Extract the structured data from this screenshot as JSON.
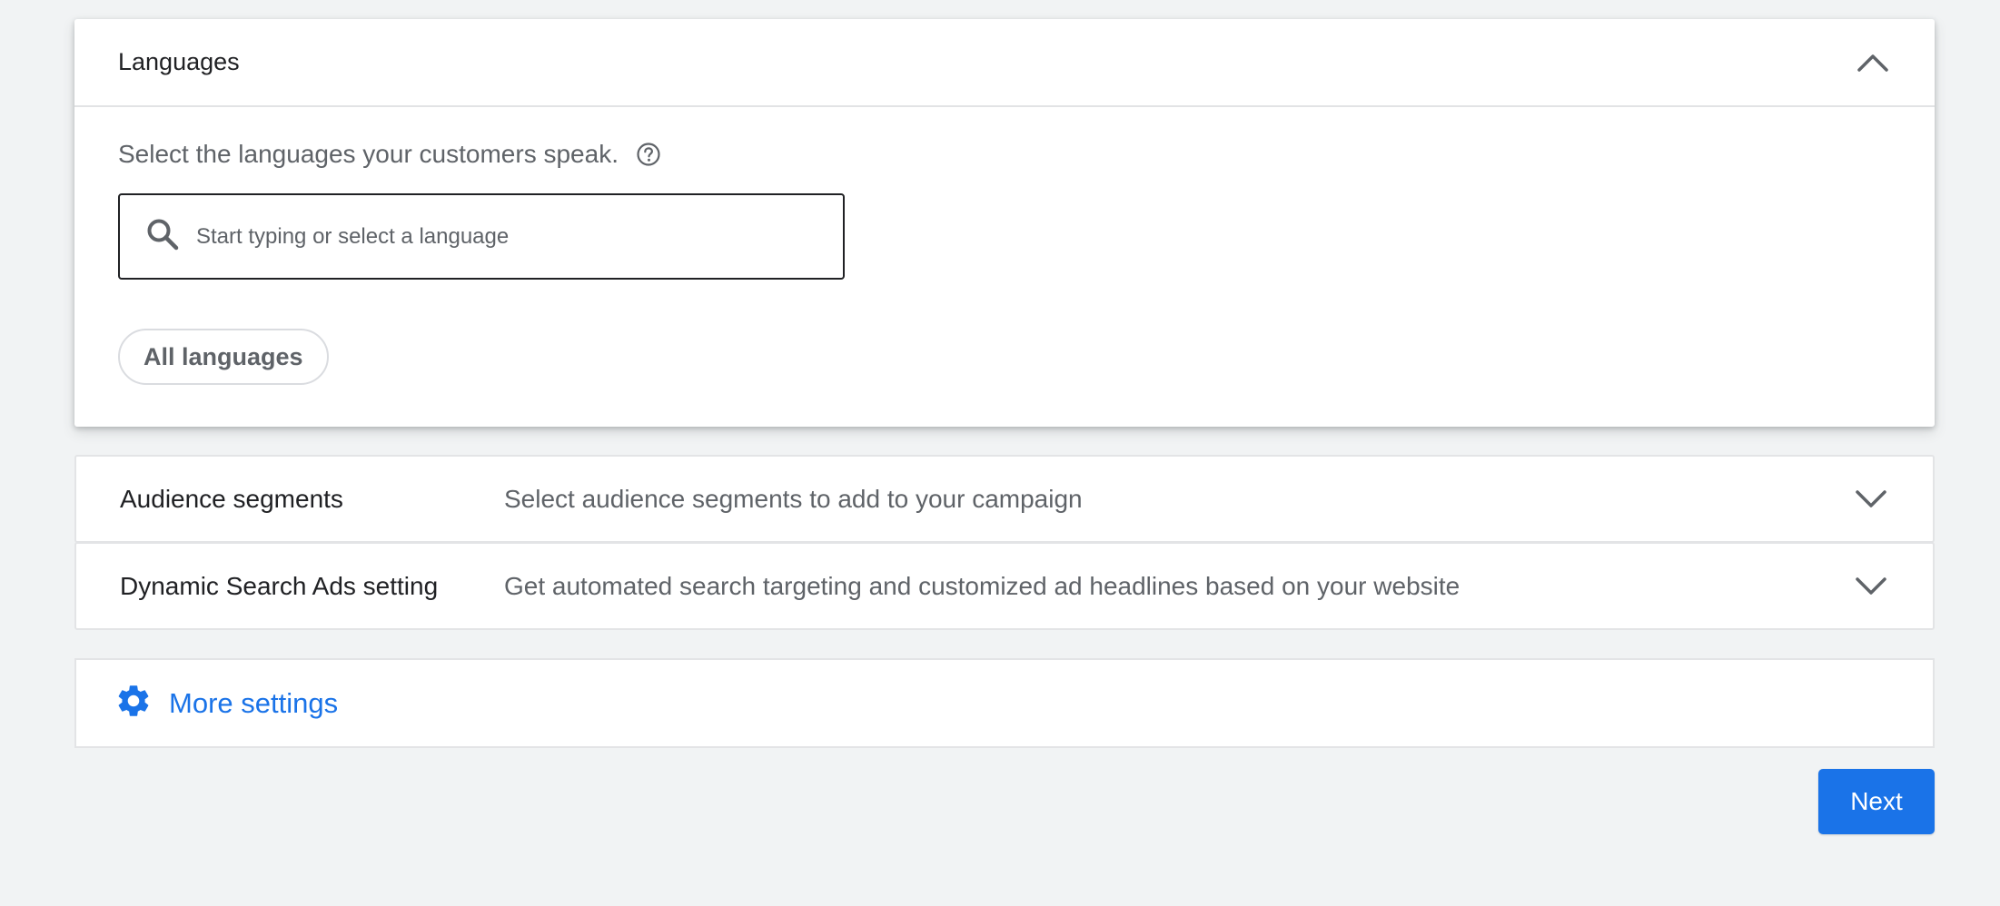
{
  "languages_section": {
    "title": "Languages",
    "description": "Select the languages your customers speak.",
    "search": {
      "placeholder": "Start typing or select a language",
      "value": ""
    },
    "chips": [
      "All languages"
    ],
    "expanded": true
  },
  "audience_segments": {
    "title": "Audience segments",
    "description": "Select audience segments to add to your campaign"
  },
  "dynamic_search_ads": {
    "title": "Dynamic Search Ads setting",
    "description": "Get automated search targeting and customized ad headlines based on your website"
  },
  "more_settings": {
    "label": "More settings"
  },
  "footer": {
    "next_label": "Next"
  },
  "icons": {
    "collapse": "chevron-up-icon",
    "expand": "chevron-down-icon",
    "help": "help-icon",
    "search": "search-icon",
    "settings": "gear-icon"
  },
  "colors": {
    "accent": "#1a73e8",
    "page_background": "#f1f3f4",
    "card_background": "#ffffff"
  }
}
